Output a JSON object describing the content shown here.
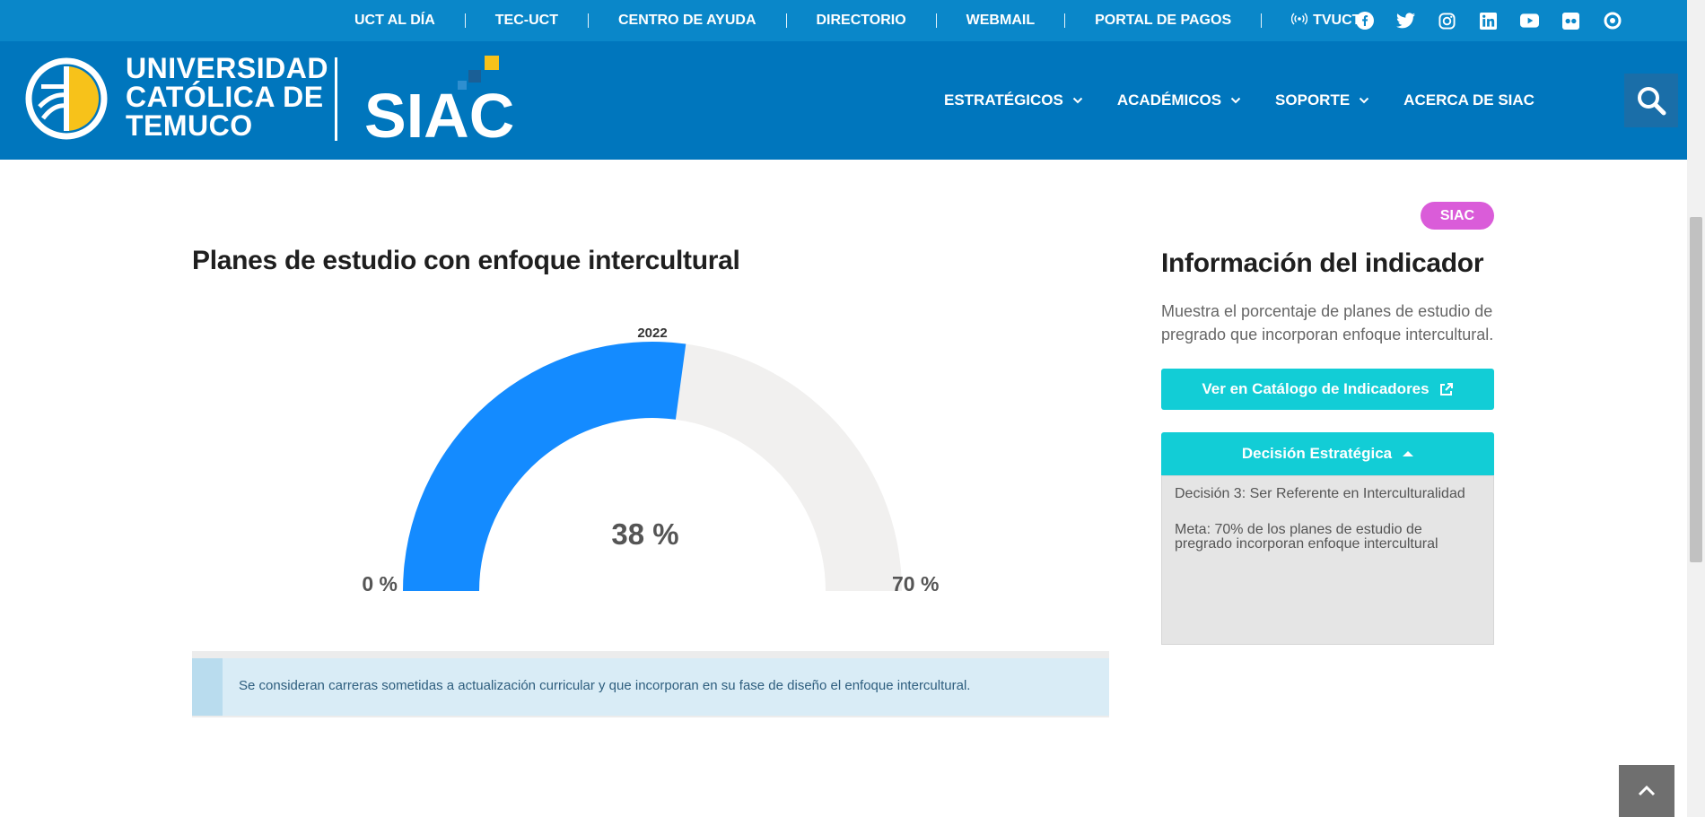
{
  "topbar": {
    "links": [
      "UCT AL DÍA",
      "TEC-UCT",
      "CENTRO DE AYUDA",
      "DIRECTORIO",
      "WEBMAIL",
      "PORTAL DE PAGOS",
      "TVUCT"
    ],
    "socials": [
      "facebook-icon",
      "twitter-icon",
      "instagram-icon",
      "linkedin-icon",
      "youtube-icon",
      "flickr-icon",
      "issuu-icon"
    ],
    "color": "#0a87c9"
  },
  "header": {
    "university": [
      "UNIVERSIDAD",
      "CATÓLICA DE",
      "TEMUCO"
    ],
    "product_logo": "SIAC",
    "nav": [
      "ESTRATÉGICOS",
      "ACADÉMICOS",
      "SOPORTE",
      "ACERCA DE SIAC"
    ],
    "color": "#0076bd"
  },
  "main": {
    "chart_title": "Planes de estudio con enfoque intercultural",
    "note": "Se consideran carreras sometidas a actualización curricular y que incorporan en su fase de diseño el enfoque intercultural."
  },
  "chart_data": {
    "type": "gauge",
    "title": "Planes de estudio con enfoque intercultural",
    "series_label": "2022",
    "value": 38,
    "min": 0,
    "max": 70,
    "value_label": "38 %",
    "min_label": "0 %",
    "max_label": "70 %",
    "colors": {
      "fill": "#148bff",
      "track": "#f1f0ef"
    }
  },
  "sidebar": {
    "badge": "SIAC",
    "title": "Información del indicador",
    "description": "Muestra el porcentaje de planes de estudio de pregrado que incorporan enfoque intercultural.",
    "catalog_button": "Ver en Catálogo de Indicadores",
    "accordion_title": "Decisión Estratégica",
    "decision": "Decisión 3: Ser Referente en Interculturalidad",
    "goal": "Meta: 70% de los planes de estudio de pregrado incorporan enfoque intercultural",
    "accent": "#12cdd6",
    "badge_color": "#da5cd9"
  }
}
